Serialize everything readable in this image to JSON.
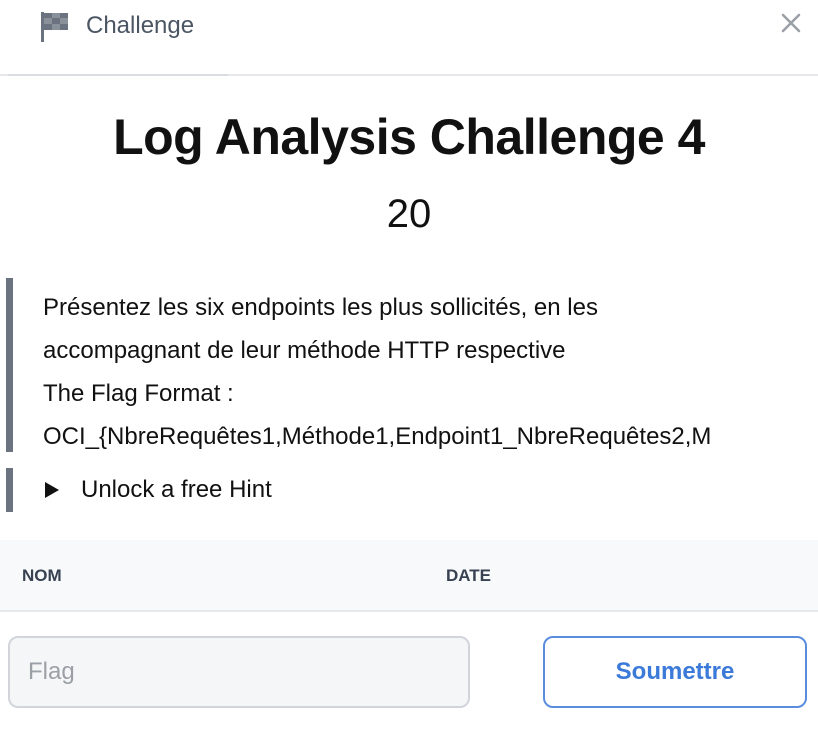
{
  "header": {
    "tab_label": "Challenge",
    "tab_icon": "flag-icon",
    "close_icon": "close-icon"
  },
  "challenge": {
    "title": "Log Analysis Challenge 4",
    "points": "20",
    "description_lines": [
      "Présentez les six endpoints les plus sollicités, en les",
      "accompagnant de leur méthode HTTP respective",
      "The Flag Format :",
      "OCI_{NbreRequêtes1,Méthode1,Endpoint1_NbreRequêtes2,M"
    ],
    "hint_label": "Unlock a free Hint"
  },
  "solves_table": {
    "columns": [
      "NOM",
      "DATE"
    ]
  },
  "submission": {
    "flag_placeholder": "Flag",
    "flag_value": "",
    "submit_label": "Soumettre"
  },
  "colors": {
    "accent": "#3b7ad9",
    "blockquote_border": "#6b7280",
    "icon_gray": "#6b7280"
  }
}
